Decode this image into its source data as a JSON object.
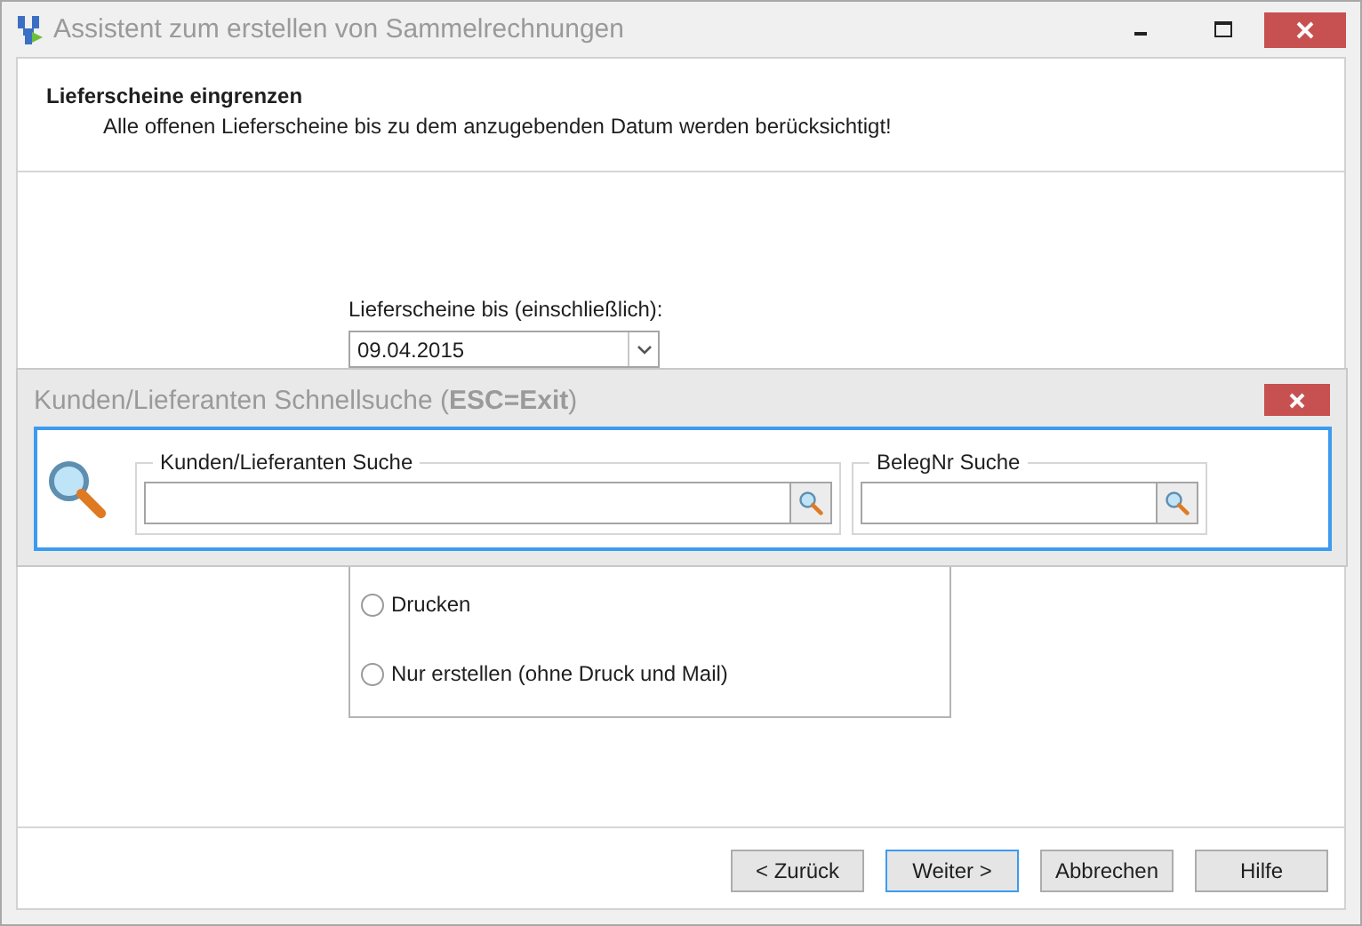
{
  "window": {
    "title": "Assistent zum erstellen von Sammelrechnungen"
  },
  "header": {
    "title": "Lieferscheine eingrenzen",
    "subtitle": "Alle offenen Lieferscheine bis zu dem anzugebenden Datum werden berücksichtigt!"
  },
  "date_field": {
    "label": "Lieferscheine bis (einschließlich):",
    "value": "09.04.2015"
  },
  "output_options": [
    {
      "label": "Drucken",
      "selected": false
    },
    {
      "label": "Nur erstellen (ohne Druck und Mail)",
      "selected": false
    }
  ],
  "buttons": [
    {
      "label": "< Zurück",
      "focused": false
    },
    {
      "label": "Weiter >",
      "focused": true
    },
    {
      "label": "Abbrechen",
      "focused": false
    },
    {
      "label": "Hilfe",
      "focused": false
    }
  ],
  "quick_search": {
    "title": "Kunden/Lieferanten Schnellsuche (**ESC=Exit**)",
    "fields": [
      {
        "legend": "Kunden/Lieferanten Suche"
      },
      {
        "legend": "BelegNr Suche"
      }
    ]
  }
}
